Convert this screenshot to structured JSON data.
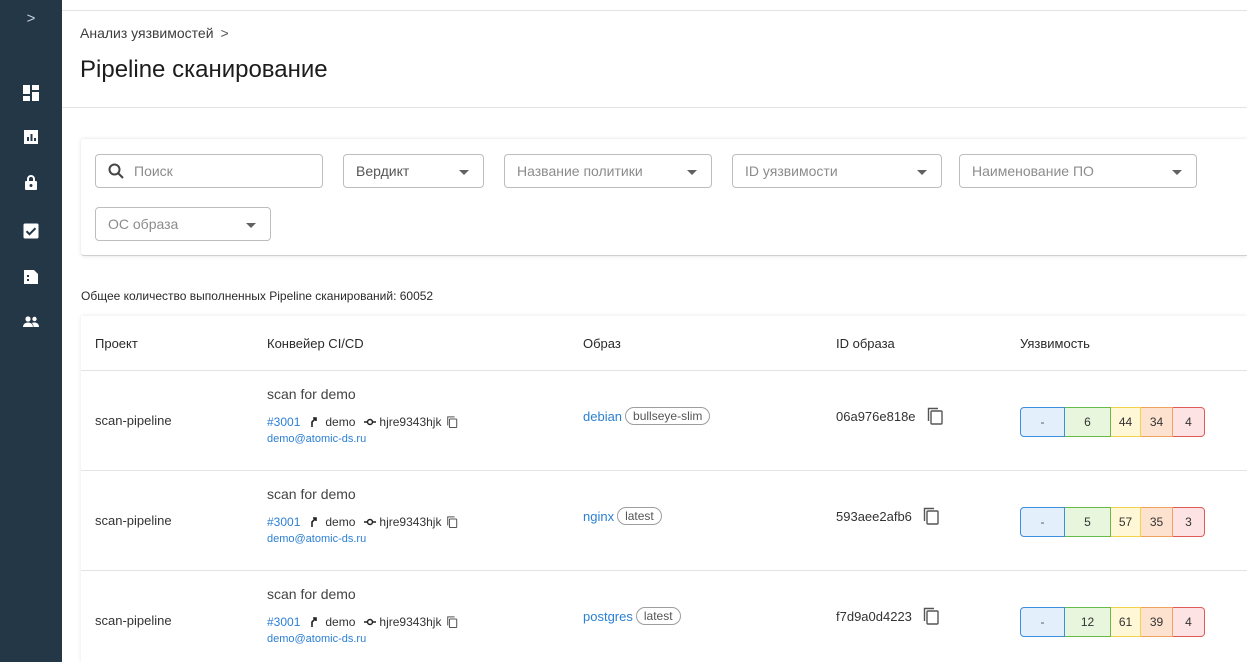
{
  "sidebar": {
    "toggle_icon": "chevron-right-icon",
    "items": [
      {
        "icon": "dashboard-icon"
      },
      {
        "icon": "report-icon"
      },
      {
        "icon": "lock-icon"
      },
      {
        "icon": "checkbox-icon"
      },
      {
        "icon": "document-icon"
      },
      {
        "icon": "users-icon"
      }
    ]
  },
  "header": {
    "breadcrumb": "Анализ уязвимостей",
    "breadcrumb_sep": ">",
    "title": "Pipeline сканирование"
  },
  "filters": {
    "search_placeholder": "Поиск",
    "verdict": "Вердикт",
    "policy": "Название политики",
    "vuln_id": "ID уязвимости",
    "software": "Наименование ПО",
    "image_os": "ОС образа"
  },
  "total_label": "Общее количество выполненных Pipeline сканирований: 60052",
  "table": {
    "columns": [
      "Проект",
      "Конвейер CI/CD",
      "Образ",
      "ID образа",
      "Уязвимость"
    ],
    "rows": [
      {
        "project": "scan-pipeline",
        "pipeline_name": "scan for demo",
        "pipeline_id": "#3001",
        "branch": "demo",
        "commit": "hjre9343hjk",
        "email": "demo@atomic-ds.ru",
        "image": "debian",
        "tag": "bullseye-slim",
        "image_id": "06a976e818e",
        "vuln": {
          "info": "-",
          "low": "6",
          "medium": "44",
          "high": "34",
          "critical": "4"
        }
      },
      {
        "project": "scan-pipeline",
        "pipeline_name": "scan for demo",
        "pipeline_id": "#3001",
        "branch": "demo",
        "commit": "hjre9343hjk",
        "email": "demo@atomic-ds.ru",
        "image": "nginx",
        "tag": "latest",
        "image_id": "593aee2afb6",
        "vuln": {
          "info": "-",
          "low": "5",
          "medium": "57",
          "high": "35",
          "critical": "3"
        }
      },
      {
        "project": "scan-pipeline",
        "pipeline_name": "scan for demo",
        "pipeline_id": "#3001",
        "branch": "demo",
        "commit": "hjre9343hjk",
        "email": "demo@atomic-ds.ru",
        "image": "postgres",
        "tag": "latest",
        "image_id": "f7d9a0d4223",
        "vuln": {
          "info": "-",
          "low": "12",
          "medium": "61",
          "high": "39",
          "critical": "4"
        }
      }
    ]
  },
  "colors": {
    "sidebar": "#243747",
    "link": "#2b7fd4",
    "info": "#3b8ee0",
    "low": "#66bb4a",
    "medium": "#f0d24b",
    "high": "#f0a160",
    "critical": "#e25b5b"
  }
}
